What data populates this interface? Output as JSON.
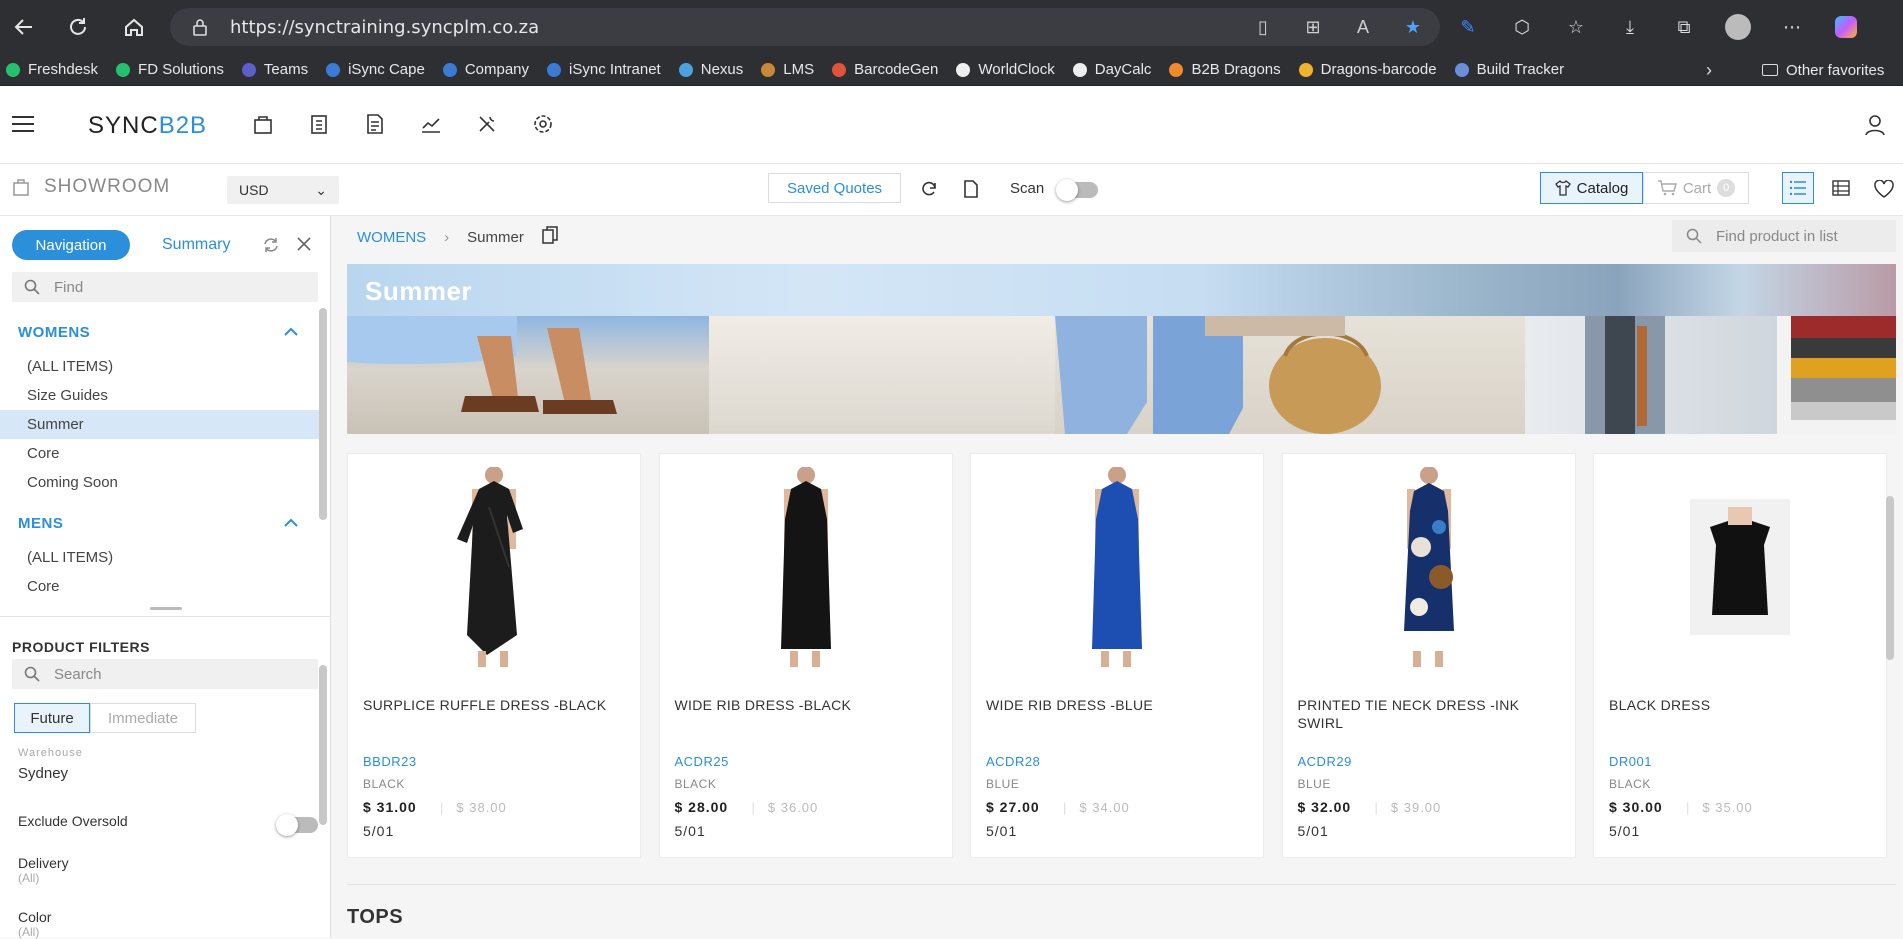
{
  "browser": {
    "url": "https://synctraining.syncplm.co.za",
    "bookmarks": [
      {
        "label": "Freshdesk",
        "color": "#25c16f"
      },
      {
        "label": "FD Solutions",
        "color": "#25c16f"
      },
      {
        "label": "Teams",
        "color": "#5b5fc7"
      },
      {
        "label": "iSync Cape",
        "color": "#3a7bd5"
      },
      {
        "label": "Company",
        "color": "#3a7bd5"
      },
      {
        "label": "iSync Intranet",
        "color": "#3a7bd5"
      },
      {
        "label": "Nexus",
        "color": "#4aa3df"
      },
      {
        "label": "LMS",
        "color": "#c8873a"
      },
      {
        "label": "BarcodeGen",
        "color": "#e0533a"
      },
      {
        "label": "WorldClock",
        "color": "#eeeeee"
      },
      {
        "label": "DayCalc",
        "color": "#eeeeee"
      },
      {
        "label": "B2B Dragons",
        "color": "#f08a2c"
      },
      {
        "label": "Dragons-barcode",
        "color": "#f0b42c"
      },
      {
        "label": "Build Tracker",
        "color": "#6a8ddc"
      }
    ],
    "other_favorites": "Other favorites"
  },
  "app": {
    "logo_sync": "SYNC",
    "logo_b2b": "B2B",
    "header_icons": [
      "bag-icon",
      "clipboard-icon",
      "invoice-icon",
      "chart-icon",
      "tools-icon",
      "gear-icon"
    ]
  },
  "toolbar": {
    "showroom": "SHOWROOM",
    "currency": "USD",
    "saved_quotes": "Saved Quotes",
    "scan": "Scan",
    "catalog": "Catalog",
    "cart": "Cart",
    "cart_count": "0"
  },
  "sidebar": {
    "tab_navigation": "Navigation",
    "tab_summary": "Summary",
    "find_placeholder": "Find",
    "groups": [
      {
        "title": "WOMENS",
        "items": [
          {
            "label": "(ALL ITEMS)",
            "selected": false
          },
          {
            "label": "Size Guides",
            "selected": false
          },
          {
            "label": "Summer",
            "selected": true
          },
          {
            "label": "Core",
            "selected": false
          },
          {
            "label": "Coming Soon",
            "selected": false
          }
        ]
      },
      {
        "title": "MENS",
        "items": [
          {
            "label": "(ALL ITEMS)",
            "selected": false
          },
          {
            "label": "Core",
            "selected": false
          }
        ]
      }
    ]
  },
  "filters": {
    "title": "PRODUCT FILTERS",
    "search_placeholder": "Search",
    "future": "Future",
    "immediate": "Immediate",
    "warehouse_label": "Warehouse",
    "warehouse_value": "Sydney",
    "exclude_oversold": "Exclude Oversold",
    "delivery_label": "Delivery",
    "delivery_value": "(All)",
    "color_label": "Color",
    "color_value": "(All)"
  },
  "main": {
    "breadcrumb_root": "WOMENS",
    "breadcrumb_current": "Summer",
    "find_product_placeholder": "Find product in list",
    "banner_title": "Summer",
    "products": [
      {
        "name": "SURPLICE RUFFLE DRESS -BLACK",
        "code": "BBDR23",
        "color": "BLACK",
        "price": "$ 31.00",
        "old_price": "$ 38.00",
        "date": "5/01",
        "dress_color": "#1c1c1c",
        "style": "wrap"
      },
      {
        "name": "WIDE RIB DRESS -BLACK",
        "code": "ACDR25",
        "color": "BLACK",
        "price": "$ 28.00",
        "old_price": "$ 36.00",
        "date": "5/01",
        "dress_color": "#141414",
        "style": "sleeveless"
      },
      {
        "name": "WIDE RIB DRESS -BLUE",
        "code": "ACDR28",
        "color": "BLUE",
        "price": "$ 27.00",
        "old_price": "$ 34.00",
        "date": "5/01",
        "dress_color": "#1d4fb3",
        "style": "sleeveless"
      },
      {
        "name": "PRINTED TIE NECK DRESS -INK SWIRL",
        "code": "ACDR29",
        "color": "BLUE",
        "price": "$ 32.00",
        "old_price": "$ 39.00",
        "date": "5/01",
        "dress_color": "#15306b",
        "style": "printed"
      },
      {
        "name": "BLACK DRESS",
        "code": "DR001",
        "color": "BLACK",
        "price": "$ 30.00",
        "old_price": "$ 35.00",
        "date": "5/01",
        "dress_color": "#111111",
        "style": "small"
      }
    ],
    "next_section": "TOPS"
  }
}
